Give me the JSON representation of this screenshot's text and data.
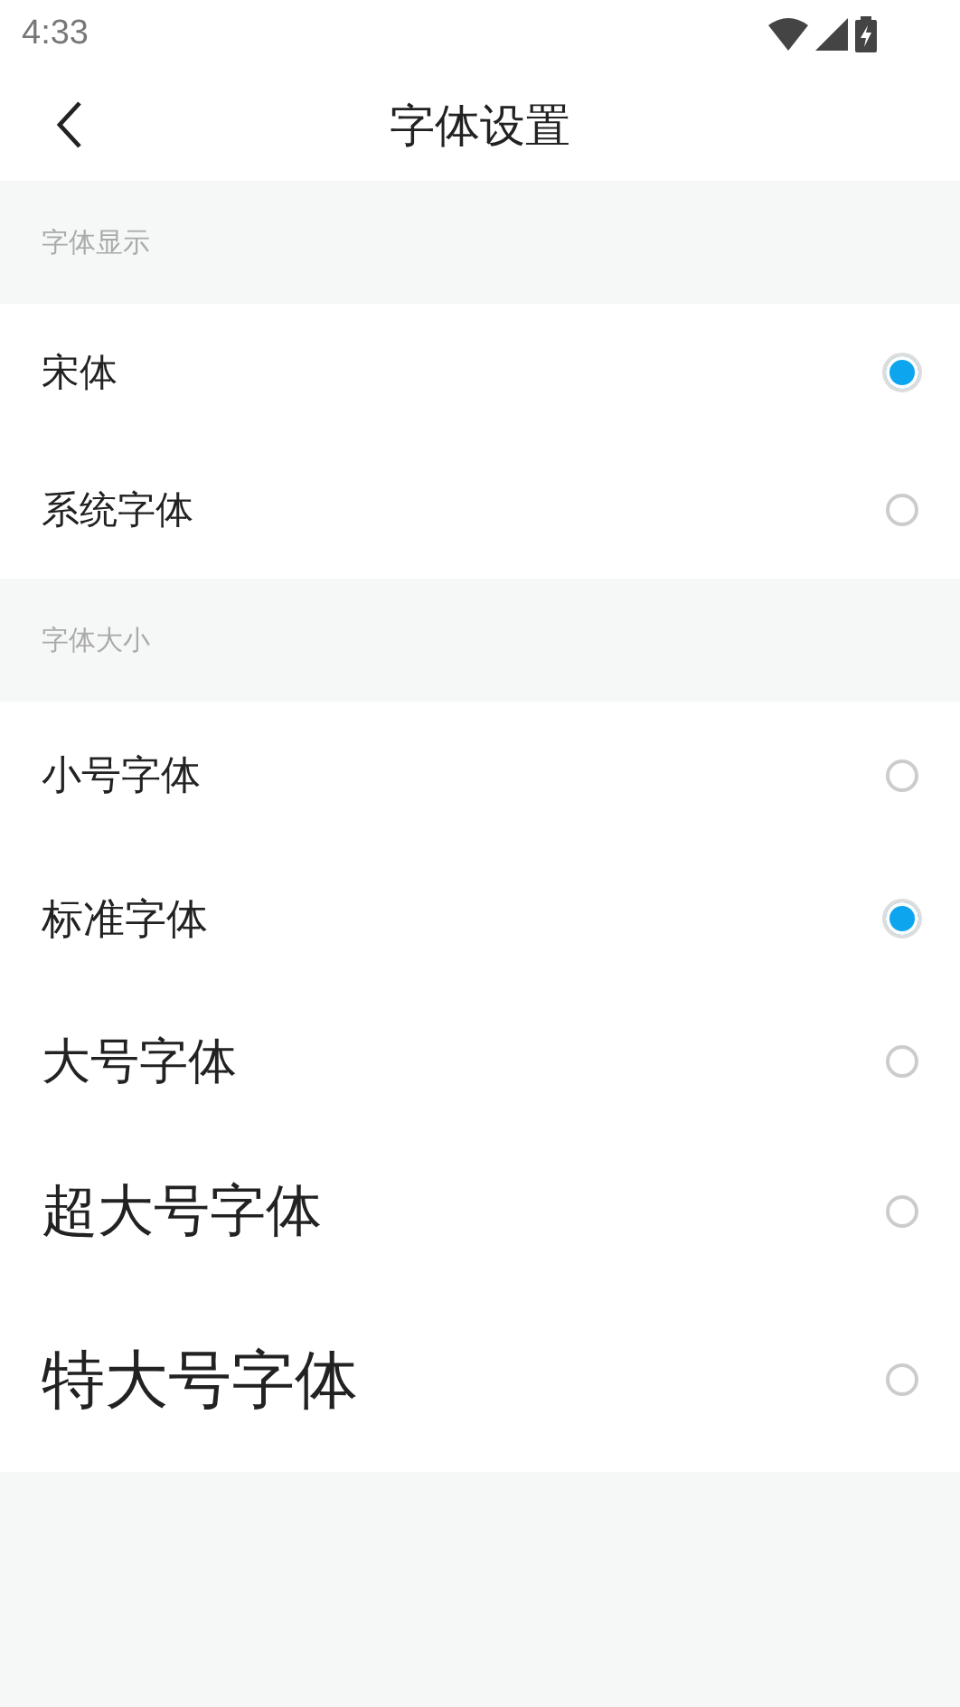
{
  "status_bar": {
    "time": "4:33"
  },
  "header": {
    "title": "字体设置"
  },
  "sections": [
    {
      "title": "字体显示",
      "options": [
        {
          "label": "宋体",
          "kind": "normal",
          "selected": true
        },
        {
          "label": "系统字体",
          "kind": "normal",
          "selected": false
        }
      ]
    },
    {
      "title": "字体大小",
      "options": [
        {
          "label": "小号字体",
          "kind": "small",
          "selected": false
        },
        {
          "label": "标准字体",
          "kind": "standard",
          "selected": true
        },
        {
          "label": "大号字体",
          "kind": "large",
          "selected": false
        },
        {
          "label": "超大号字体",
          "kind": "xlarge",
          "selected": false
        },
        {
          "label": "特大号字体",
          "kind": "xxlarge",
          "selected": false
        }
      ]
    }
  ]
}
